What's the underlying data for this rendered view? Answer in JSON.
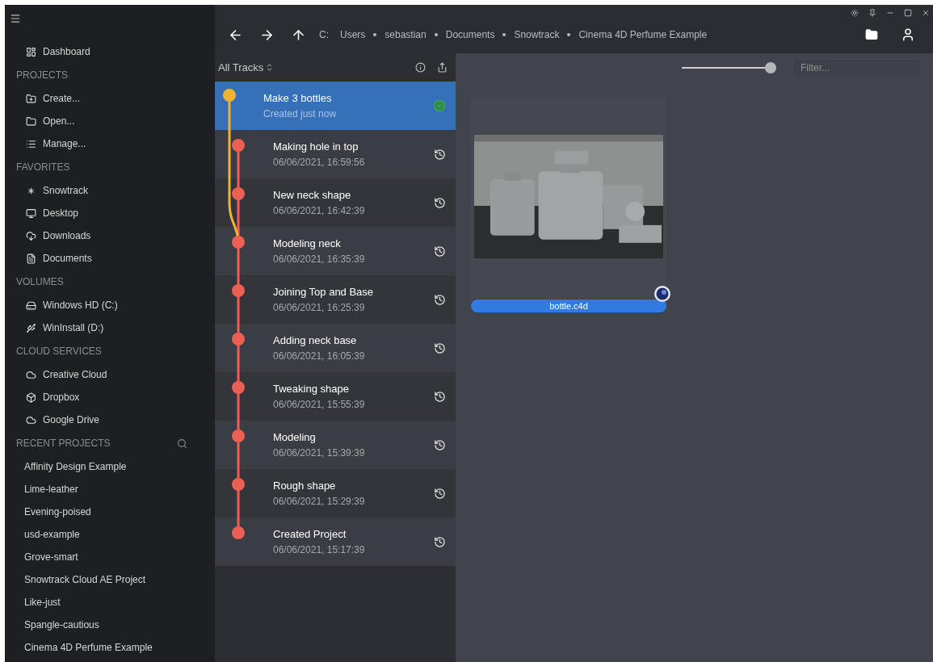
{
  "sidebar": {
    "sections": [
      {
        "items": [
          "Dashboard"
        ]
      },
      {
        "heading": "PROJECTS",
        "items": [
          "Create...",
          "Open...",
          "Manage..."
        ]
      },
      {
        "heading": "FAVORITES",
        "items": [
          "Snowtrack",
          "Desktop",
          "Downloads",
          "Documents"
        ]
      },
      {
        "heading": "VOLUMES",
        "items": [
          "Windows HD (C:)",
          "WinInstall (D:)"
        ]
      },
      {
        "heading": "CLOUD SERVICES",
        "items": [
          "Creative Cloud",
          "Dropbox",
          "Google Drive"
        ]
      }
    ],
    "recent": {
      "heading": "RECENT PROJECTS",
      "items": [
        "Affinity Design Example",
        "Lime-leather",
        "Evening-poised",
        "usd-example",
        "Grove-smart",
        "Snowtrack Cloud AE Project",
        "Like-just",
        "Spangle-cautious",
        "Cinema 4D Perfume Example"
      ]
    }
  },
  "breadcrumb": [
    "C:",
    "Users",
    "sebastian",
    "Documents",
    "Snowtrack",
    "Cinema 4D Perfume Example"
  ],
  "tracks_header": {
    "label": "All Tracks"
  },
  "tracks": [
    {
      "title": "Make 3 bottles",
      "subtitle": "Created just now",
      "selected": true,
      "kind": "current",
      "color": "#f2b233"
    },
    {
      "title": "Making hole in top",
      "subtitle": "06/06/2021, 16:59:56",
      "selected": false,
      "kind": "past",
      "color": "#eb5f55"
    },
    {
      "title": "New neck shape",
      "subtitle": "06/06/2021, 16:42:39",
      "selected": false,
      "kind": "past",
      "color": "#eb5f55"
    },
    {
      "title": "Modeling neck",
      "subtitle": "06/06/2021, 16:35:39",
      "selected": false,
      "kind": "past",
      "color": "#eb5f55"
    },
    {
      "title": "Joining Top and Base",
      "subtitle": "06/06/2021, 16:25:39",
      "selected": false,
      "kind": "past",
      "color": "#eb5f55"
    },
    {
      "title": "Adding neck base",
      "subtitle": "06/06/2021, 16:05:39",
      "selected": false,
      "kind": "past",
      "color": "#eb5f55"
    },
    {
      "title": "Tweaking shape",
      "subtitle": "06/06/2021, 15:55:39",
      "selected": false,
      "kind": "past",
      "color": "#eb5f55"
    },
    {
      "title": "Modeling",
      "subtitle": "06/06/2021, 15:39:39",
      "selected": false,
      "kind": "past",
      "color": "#eb5f55"
    },
    {
      "title": "Rough shape",
      "subtitle": "06/06/2021, 15:29:39",
      "selected": false,
      "kind": "past",
      "color": "#eb5f55"
    },
    {
      "title": "Created Project",
      "subtitle": "06/06/2021, 15:17:39",
      "selected": false,
      "kind": "past",
      "color": "#eb5f55"
    }
  ],
  "toolbar": {
    "zoom_slider": {
      "level": 1
    },
    "filter": {
      "placeholder": "Filter..."
    }
  },
  "files": [
    {
      "name": "bottle.c4d",
      "kind": "picture"
    }
  ]
}
